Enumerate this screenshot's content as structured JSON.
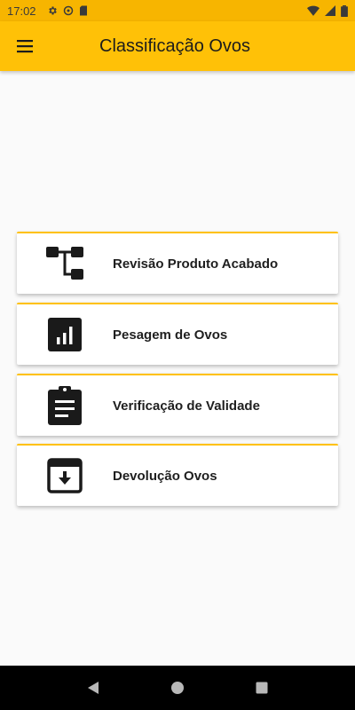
{
  "status_bar": {
    "time": "17:02",
    "left_icons": [
      "gear-icon",
      "at-sign-icon",
      "sd-card-icon"
    ],
    "right_icons": [
      "wifi-icon",
      "signal-icon",
      "battery-icon"
    ]
  },
  "app_bar": {
    "menu_icon": "hamburger-menu-icon",
    "title": "Classificação Ovos",
    "color": "#ffc107"
  },
  "cards": [
    {
      "label": "Revisão Produto Acabado",
      "icon": "flow-tree-icon"
    },
    {
      "label": "Pesagem de Ovos",
      "icon": "bar-chart-icon"
    },
    {
      "label": "Verificação de Validade",
      "icon": "clipboard-icon"
    },
    {
      "label": "Devolução Ovos",
      "icon": "archive-download-icon"
    }
  ],
  "accent_color": "#ffc107",
  "nav_bar": {
    "back_icon": "back-triangle-icon",
    "home_icon": "home-circle-icon",
    "recents_icon": "recents-square-icon"
  }
}
